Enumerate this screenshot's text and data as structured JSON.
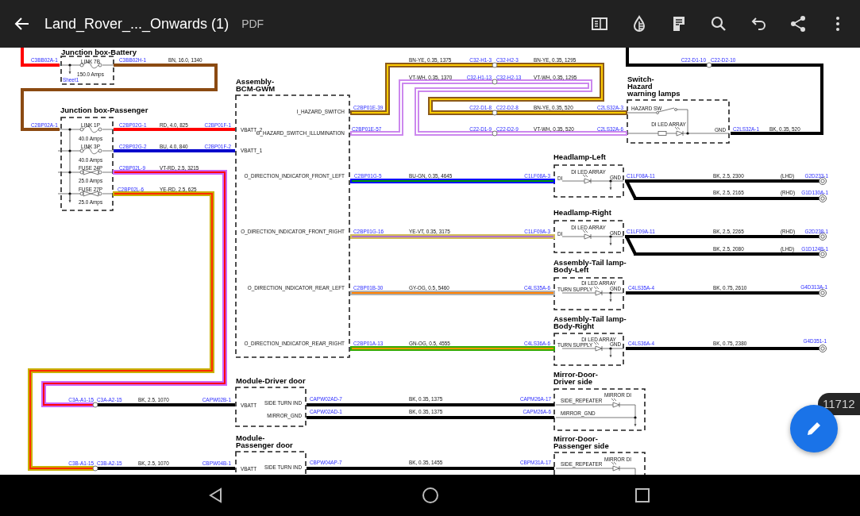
{
  "app_bar": {
    "title": "Land_Rover_..._Onwards (1)",
    "file_type": "PDF"
  },
  "diagram": {
    "components": [
      {
        "title_lines": [
          "Junction box-Battery"
        ],
        "labels": [
          "LINK 7B",
          "150.0 Amps"
        ],
        "pins": [
          "Sheet1"
        ]
      },
      {
        "title_lines": [
          "Junction box-Passenger"
        ],
        "labels": [
          "LINK 1P",
          "40.0 Amps",
          "LINK 3P",
          "40.0 Amps",
          "FUSE 24P",
          "25.0 Amps",
          "FUSE 27P",
          "25.0 Amps"
        ]
      },
      {
        "title_lines": [
          "Assembly-",
          "BCM-GWM"
        ],
        "labels": [
          "VBATT_2",
          "VBATT_1",
          "I_HAZARD_SWITCH",
          "O_HAZARD_SWITCH_ILLUMINATION",
          "O_DIRECTION_INDICATOR_FRONT_LEFT",
          "O_DIRECTION_INDICATOR_FRONT_RIGHT",
          "O_DIRECTION_INDICATOR_REAR_LEFT",
          "O_DIRECTION_INDICATOR_REAR_RIGHT"
        ]
      },
      {
        "title_lines": [
          "Switch-",
          "Hazard",
          "warning lamps"
        ],
        "labels": [
          "HAZARD SW",
          "DI LED ARRAY",
          "GND"
        ]
      },
      {
        "title_lines": [
          "Headlamp-Left"
        ],
        "labels": [
          "DI",
          "DI LED ARRAY",
          "GND"
        ]
      },
      {
        "title_lines": [
          "Headlamp-Right"
        ],
        "labels": [
          "DI",
          "DI LED ARRAY",
          "GND"
        ]
      },
      {
        "title_lines": [
          "Assembly-Tail lamp-",
          "Body-Left"
        ],
        "labels": [
          "TURN SUPPLY",
          "DI LED ARRAY",
          "GND"
        ]
      },
      {
        "title_lines": [
          "Assembly-Tail lamp-",
          "Body-Right"
        ],
        "labels": [
          "TURN SUPPLY",
          "DI LED ARRAY",
          "GND"
        ]
      },
      {
        "title_lines": [
          "Module-Driver door"
        ],
        "labels": [
          "VBATT",
          "SIDE TURN IND",
          "MIRROR_GND"
        ]
      },
      {
        "title_lines": [
          "Mirror-Door-",
          "Driver side"
        ],
        "labels": [
          "SIDE_REPEATER",
          "MIRROR DI",
          "MIRROR_GND"
        ]
      },
      {
        "title_lines": [
          "Module-",
          "Passenger door"
        ],
        "labels": [
          "VBATT",
          "SIDE TURN IND"
        ]
      },
      {
        "title_lines": [
          "Mirror-Door-",
          "Passenger side"
        ],
        "labels": [
          "SIDE_REPEATER",
          "MIRROR DI"
        ]
      }
    ],
    "wires": [
      {
        "color": "#ff0000",
        "pins": [
          "C3BB02A-1"
        ]
      },
      {
        "color": "#8b4a12",
        "pins": [
          "C3BB02H-1",
          "C2BP02A-1"
        ],
        "specs": [
          "BN, 16.0, 1340"
        ]
      },
      {
        "color": "#ff0000",
        "pins": [
          "C2BP02G-1",
          "C2BP01F-1"
        ],
        "specs": [
          "RD, 4.0, 825"
        ]
      },
      {
        "color": "#0000cc",
        "pins": [
          "C2BP02G-2",
          "C2BP01F-2"
        ],
        "specs": [
          "BU, 4.0, 840"
        ]
      },
      {
        "color": "#cc66ff",
        "stripe": {
          "color": "#ff0000"
        },
        "pins": [
          "C2BP02L-9",
          "C3A-A1-15"
        ],
        "specs": [
          "VT-RD, 2.5, 3215"
        ]
      },
      {
        "color": "#c8b000",
        "stripe": {
          "color": "#ff2a00"
        },
        "pins": [
          "C2BP02L-6",
          "C3B-A1-15"
        ],
        "specs": [
          "YE-RD, 2.5, 625"
        ]
      },
      {
        "color": "#000000",
        "pins": [
          "C3A-A2-15",
          "CAPW02B-1"
        ],
        "specs": [
          "BK, 2.5, 1070"
        ]
      },
      {
        "color": "#000000",
        "pins": [
          "C3B-A2-15",
          "CBPW04B-1"
        ],
        "specs": [
          "BK, 2.5, 1070"
        ]
      },
      {
        "color": "#8b5a1b",
        "stripe": {
          "color": "#ffcc00"
        },
        "pins": [
          "C2BP01E-39",
          "C32-H1-3"
        ],
        "specs": [
          "BN-YE, 0.35, 1375"
        ]
      },
      {
        "color": "#8b5a1b",
        "stripe": {
          "color": "#ffcc00"
        },
        "pins": [
          "C32-H2-3",
          "C22-D1-8"
        ],
        "specs": [
          "BN-YE, 0.35, 1295"
        ]
      },
      {
        "color": "#8b5a1b",
        "stripe": {
          "color": "#ffcc00"
        },
        "pins": [
          "C22-D2-8",
          "C2LS32A-3"
        ],
        "specs": [
          "BN-YE, 0.35, 520"
        ]
      },
      {
        "color": "#cc88ee",
        "stripe": {
          "color": "#ffffff"
        },
        "pins": [
          "C2BP01E-57",
          "C32-H1-13"
        ],
        "specs": [
          "VT-WH, 0.35, 1370"
        ]
      },
      {
        "color": "#cc88ee",
        "stripe": {
          "color": "#ffffff"
        },
        "pins": [
          "C32-H2-13",
          "C22-D1-9"
        ],
        "specs": [
          "VT-WH, 0.35, 1295"
        ]
      },
      {
        "color": "#cc88ee",
        "stripe": {
          "color": "#ffffff"
        },
        "pins": [
          "C22-D2-9",
          "C2LS32A-6"
        ],
        "specs": [
          "VT-WH, 0.35, 520"
        ]
      },
      {
        "color": "#000000",
        "pins": [
          "C22-D1-10"
        ]
      },
      {
        "color": "#000000",
        "pins": [
          "C22-D2-10",
          "C2LS32A-1"
        ],
        "specs": [
          "BK, 0.35, 520"
        ]
      },
      {
        "color": "#0000ff",
        "stripe": {
          "color": "#009900"
        },
        "pins": [
          "C2BP01G-5",
          "C1LF08A-3"
        ],
        "specs": [
          "BU-GN, 0.35, 4645"
        ]
      },
      {
        "color": "#d2bc5a",
        "stripe": {
          "color": "#b070c8"
        },
        "pins": [
          "C2BP01G-16",
          "C1LF09A-3"
        ],
        "specs": [
          "YE-VT, 0.35, 3175"
        ]
      },
      {
        "color": "#b0b0b0",
        "stripe": {
          "color": "#ff8000"
        },
        "pins": [
          "C2BP01B-30",
          "C4LS35A-6"
        ],
        "specs": [
          "GY-OG, 0.5, 5460"
        ]
      },
      {
        "color": "#33aa00",
        "stripe": {
          "color": "#ff9900"
        },
        "pins": [
          "C2BP01A-13",
          "C4LS36A-6"
        ],
        "specs": [
          "GN-OG, 0.5, 4555"
        ]
      },
      {
        "color": "#000000",
        "pins": [
          "C1LF08A-11",
          "G2D233-1"
        ],
        "specs": [
          "BK, 2.5, 2300",
          "(LHD)"
        ]
      },
      {
        "color": "#000000",
        "pins": [
          "G1D130A-1"
        ],
        "specs": [
          "BK, 2.5, 2165",
          "(RHD)"
        ]
      },
      {
        "color": "#000000",
        "pins": [
          "C1LF09A-11",
          "G2D238-1"
        ],
        "specs": [
          "BK, 2.5, 2265",
          "(RHD)"
        ]
      },
      {
        "color": "#000000",
        "pins": [
          "G1D124B-1"
        ],
        "specs": [
          "BK, 2.5, 2080",
          "(LHD)"
        ]
      },
      {
        "color": "#000000",
        "pins": [
          "C4LS35A-4",
          "G4D313A-1"
        ],
        "specs": [
          "BK, 0.75, 2610"
        ]
      },
      {
        "color": "#000000",
        "pins": [
          "C4LS36A-4",
          "G4D351-1"
        ],
        "specs": [
          "BK, 0.75, 2380"
        ]
      },
      {
        "color": "#000000",
        "pins": [
          "CAPW02AD-7",
          "CAPM26A-17"
        ],
        "specs": [
          "BK, 0.35, 1375"
        ]
      },
      {
        "color": "#000000",
        "pins": [
          "CAPW02AD-1",
          "CAPM26A-6"
        ],
        "specs": [
          "BK, 0.35, 1375"
        ]
      },
      {
        "color": "#000000",
        "pins": [
          "CBPW04AP-7",
          "CBPM31A-17"
        ],
        "specs": [
          "BK, 0.35, 1455"
        ]
      }
    ]
  },
  "page_number": "11712"
}
